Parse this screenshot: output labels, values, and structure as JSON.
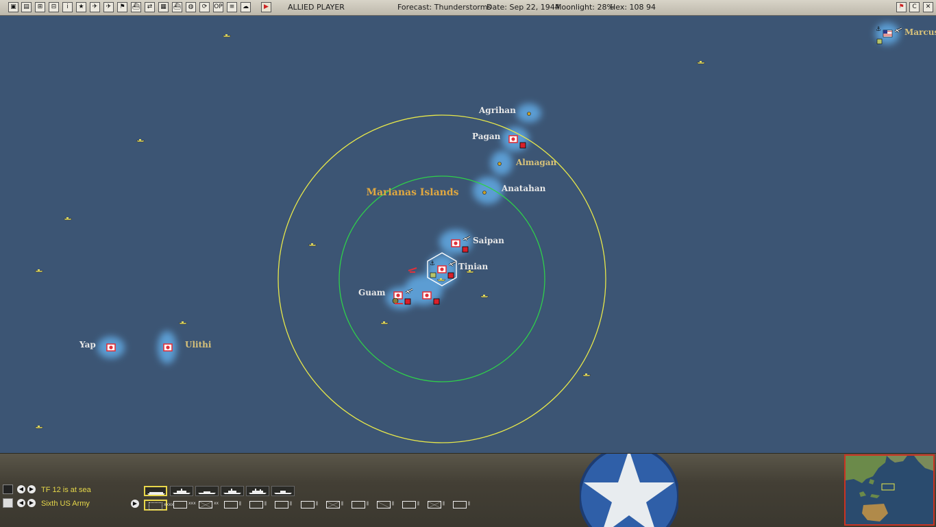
{
  "topbar": {
    "buttons": [
      {
        "name": "menu-button-1",
        "glyph": "▣"
      },
      {
        "name": "reports-button",
        "glyph": "▤"
      },
      {
        "name": "ships-list-button",
        "glyph": "⊞"
      },
      {
        "name": "task-forces-button",
        "glyph": "⊟"
      },
      {
        "name": "info-button",
        "glyph": "i"
      },
      {
        "name": "air-units-button",
        "glyph": "★"
      },
      {
        "name": "aircraft-button",
        "glyph": "✈"
      },
      {
        "name": "air-groups-button",
        "glyph": "✈"
      },
      {
        "name": "flag-button",
        "glyph": "⚑"
      },
      {
        "name": "naval-button",
        "glyph": "⛴"
      },
      {
        "name": "swap-button",
        "glyph": "⇄"
      },
      {
        "name": "map-button",
        "glyph": "▦"
      },
      {
        "name": "fleet-button",
        "glyph": "⛴"
      },
      {
        "name": "globe-button",
        "glyph": "◍"
      },
      {
        "name": "cycle-button",
        "glyph": "⟳"
      },
      {
        "name": "op-button",
        "glyph": "OP"
      },
      {
        "name": "list-button",
        "glyph": "≡"
      },
      {
        "name": "weather-button",
        "glyph": "☁"
      },
      {
        "name": "end-turn-button",
        "glyph": "▶"
      }
    ],
    "player": "ALLIED PLAYER",
    "forecast": "Forecast: Thunderstorms",
    "date": "Date: Sep 22, 1944",
    "moonlight": "Moonlight: 28%",
    "hex": "Hex: 108 94",
    "right_buttons": [
      {
        "name": "report-flag-button",
        "glyph": "⚑"
      },
      {
        "name": "combat-button",
        "glyph": "C"
      },
      {
        "name": "close-button",
        "glyph": "✕"
      }
    ]
  },
  "map": {
    "labels": {
      "region": "Marianas Islands",
      "agrihan": "Agrihan",
      "pagan": "Pagan",
      "almagan": "Almagan",
      "anatahan": "Anatahan",
      "saipan": "Saipan",
      "tinian": "Tinian",
      "guam": "Guam",
      "yap": "Yap",
      "ulithi": "Ulithi",
      "marcus": "Marcus"
    },
    "colors": {
      "ocean": "#3c5574",
      "shallow": "#5a9bd0",
      "range_outer": "#e8e84a",
      "range_inner": "#2fd04a",
      "japan_base": "#e0303a",
      "allied_label": "#d8c27a"
    }
  },
  "bottom": {
    "tf_status": "TF 12 is at sea",
    "army_status": "Sixth US Army"
  }
}
